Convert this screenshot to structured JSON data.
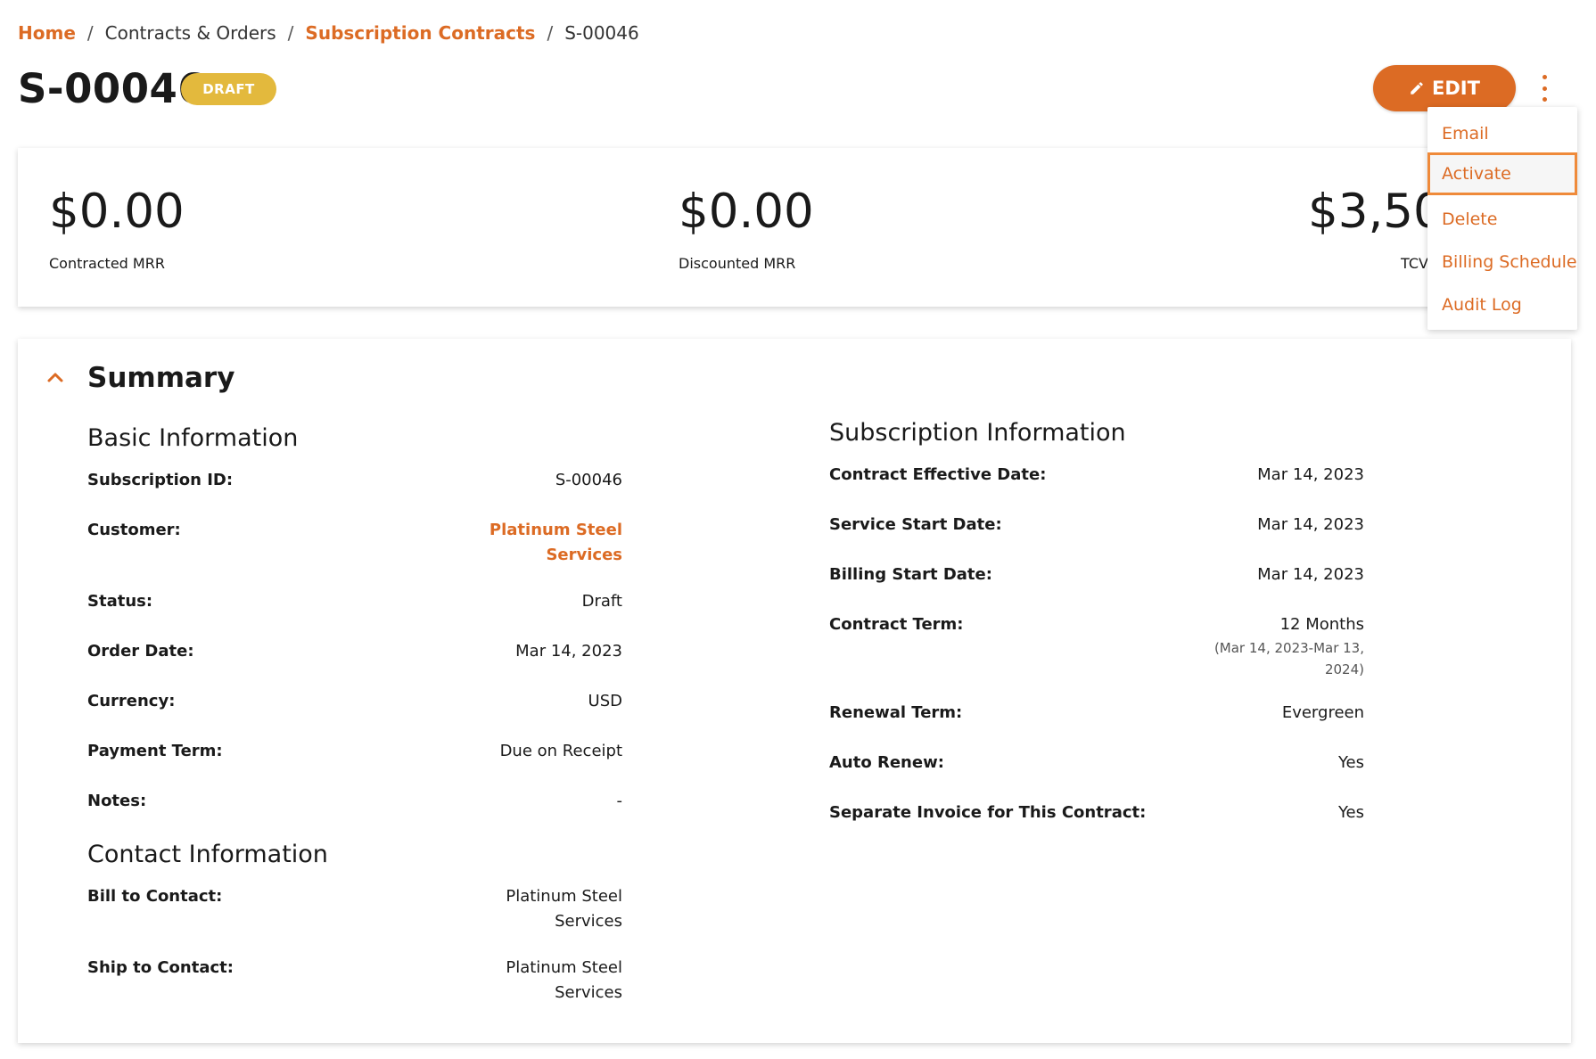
{
  "breadcrumb": {
    "home": "Home",
    "contracts_orders": "Contracts & Orders",
    "subscription_contracts": "Subscription Contracts",
    "current": "S-00046",
    "separator": "/"
  },
  "header": {
    "title": "S-00046",
    "status_badge": "DRAFT",
    "edit_label": "EDIT"
  },
  "metrics": [
    {
      "value": "$0.00",
      "label": "Contracted MRR"
    },
    {
      "value": "$0.00",
      "label": "Discounted MRR"
    },
    {
      "value": "$3,500",
      "label": "TCV"
    }
  ],
  "menu": {
    "items": [
      "Email",
      "Activate",
      "Delete",
      "Billing Schedule",
      "Audit Log"
    ],
    "highlighted": "Activate"
  },
  "summary": {
    "title": "Summary",
    "basic": {
      "heading": "Basic Information",
      "rows": [
        {
          "label": "Subscription ID:",
          "value": "S-00046"
        },
        {
          "label": "Customer:",
          "value_line1": "Platinum Steel",
          "value_line2": "Services"
        },
        {
          "label": "Status:",
          "value": "Draft"
        },
        {
          "label": "Order Date:",
          "value": "Mar 14, 2023"
        },
        {
          "label": "Currency:",
          "value": "USD"
        },
        {
          "label": "Payment Term:",
          "value": "Due on Receipt"
        },
        {
          "label": "Notes:",
          "value": "-"
        }
      ]
    },
    "contact": {
      "heading": "Contact Information",
      "rows": [
        {
          "label": "Bill to Contact:",
          "value_line1": "Platinum Steel",
          "value_line2": "Services"
        },
        {
          "label": "Ship to Contact:",
          "value_line1": "Platinum Steel",
          "value_line2": "Services"
        }
      ]
    },
    "subscription": {
      "heading": "Subscription Information",
      "rows": [
        {
          "label": "Contract Effective Date:",
          "value": "Mar 14, 2023"
        },
        {
          "label": "Service Start Date:",
          "value": "Mar 14, 2023"
        },
        {
          "label": "Billing Start Date:",
          "value": "Mar 14, 2023"
        },
        {
          "label": "Contract Term:",
          "value": "12 Months",
          "note_line1": "(Mar 14, 2023-Mar 13,",
          "note_line2": "2024)"
        },
        {
          "label": "Renewal Term:",
          "value": "Evergreen"
        },
        {
          "label": "Auto Renew:",
          "value": "Yes"
        },
        {
          "label": "Separate Invoice for This Contract:",
          "value": "Yes"
        }
      ]
    }
  },
  "colors": {
    "accent": "#dc6b24",
    "badge": "#e3b93d",
    "menu_highlight_border": "#ef8a3a"
  }
}
